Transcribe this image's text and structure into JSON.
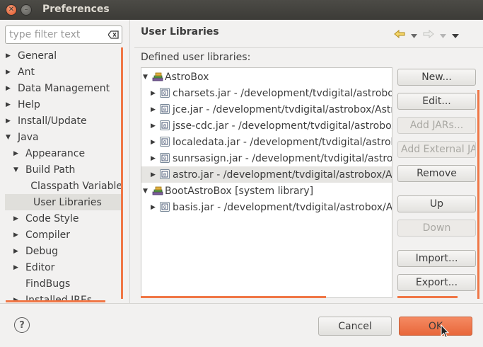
{
  "window": {
    "title": "Preferences"
  },
  "filter": {
    "placeholder": "type filter text"
  },
  "nav": [
    {
      "label": "General",
      "level": 0,
      "arrow": "▶"
    },
    {
      "label": "Ant",
      "level": 0,
      "arrow": "▶"
    },
    {
      "label": "Data Management",
      "level": 0,
      "arrow": "▶"
    },
    {
      "label": "Help",
      "level": 0,
      "arrow": "▶"
    },
    {
      "label": "Install/Update",
      "level": 0,
      "arrow": "▶"
    },
    {
      "label": "Java",
      "level": 0,
      "arrow": "▼"
    },
    {
      "label": "Appearance",
      "level": 1,
      "arrow": "▶"
    },
    {
      "label": "Build Path",
      "level": 1,
      "arrow": "▼"
    },
    {
      "label": "Classpath Variable",
      "level": 2,
      "arrow": ""
    },
    {
      "label": "User Libraries",
      "level": 2,
      "arrow": "",
      "selected": true
    },
    {
      "label": "Code Style",
      "level": 1,
      "arrow": "▶"
    },
    {
      "label": "Compiler",
      "level": 1,
      "arrow": "▶"
    },
    {
      "label": "Debug",
      "level": 1,
      "arrow": "▶"
    },
    {
      "label": "Editor",
      "level": 1,
      "arrow": "▶"
    },
    {
      "label": "FindBugs",
      "level": 1,
      "arrow": ""
    },
    {
      "label": "Installed JREs",
      "level": 1,
      "arrow": "▶"
    }
  ],
  "page": {
    "title": "User Libraries",
    "list_label": "Defined user libraries:"
  },
  "libraries": [
    {
      "label": "AstroBox",
      "level": 0,
      "arrow": "▼",
      "icon": "library-icon"
    },
    {
      "label": "charsets.jar - /development/tvdigital/astrobox/",
      "level": 1,
      "arrow": "▶",
      "icon": "jar-icon"
    },
    {
      "label": "jce.jar - /development/tvdigital/astrobox/Astro",
      "level": 1,
      "arrow": "▶",
      "icon": "jar-icon"
    },
    {
      "label": "jsse-cdc.jar - /development/tvdigital/astrobox/",
      "level": 1,
      "arrow": "▶",
      "icon": "jar-icon"
    },
    {
      "label": "localedata.jar - /development/tvdigital/astrob",
      "level": 1,
      "arrow": "▶",
      "icon": "jar-icon"
    },
    {
      "label": "sunrsasign.jar - /development/tvdigital/astrob",
      "level": 1,
      "arrow": "▶",
      "icon": "jar-icon"
    },
    {
      "label": "astro.jar - /development/tvdigital/astrobox/As",
      "level": 1,
      "arrow": "▶",
      "icon": "jar-icon",
      "selected": true
    },
    {
      "label": "BootAstroBox [system library]",
      "level": 0,
      "arrow": "▼",
      "icon": "library-icon"
    },
    {
      "label": "basis.jar - /development/tvdigital/astrobox/As",
      "level": 1,
      "arrow": "▶",
      "icon": "jar-icon"
    }
  ],
  "buttons": {
    "new": "New...",
    "edit": "Edit...",
    "add_jars": "Add JARs...",
    "add_external": "Add External JA",
    "remove": "Remove",
    "up": "Up",
    "down": "Down",
    "import": "Import...",
    "export": "Export..."
  },
  "dialog": {
    "help": "?",
    "cancel": "Cancel",
    "ok": "OK"
  },
  "colors": {
    "accent": "#f07746",
    "ok_button": "#e8673b",
    "titlebar": "#3c3b37"
  }
}
